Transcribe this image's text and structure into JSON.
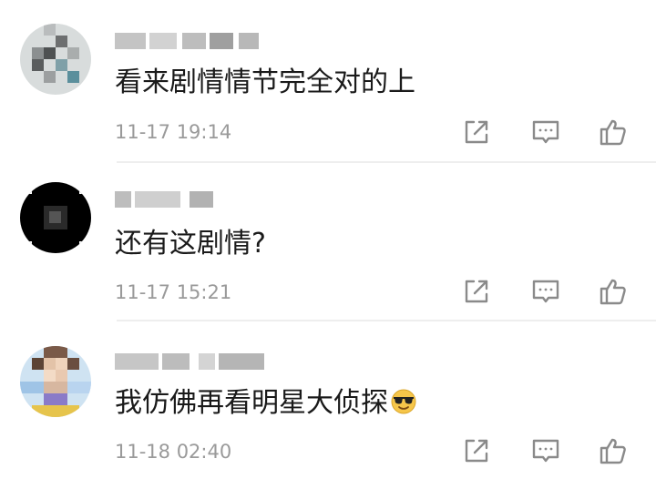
{
  "comments": [
    {
      "text": "看来剧情情节完全对的上",
      "time": "11-17 19:14",
      "icons": {
        "share": "share-icon",
        "reply": "comment-icon",
        "like": "thumbs-up-icon"
      }
    },
    {
      "text": "还有这剧情?",
      "time": "11-17 15:21",
      "icons": {
        "share": "share-icon",
        "reply": "comment-icon",
        "like": "thumbs-up-icon"
      }
    },
    {
      "text": "我仿佛再看明星大侦探",
      "time": "11-18 02:40",
      "emoji": "sunglasses-emoji",
      "icons": {
        "share": "share-icon",
        "reply": "comment-icon",
        "like": "thumbs-up-icon"
      }
    }
  ]
}
